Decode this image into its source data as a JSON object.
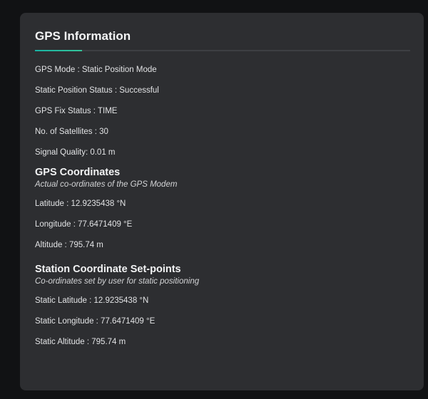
{
  "card": {
    "title": "GPS Information",
    "info_rows": [
      "GPS Mode : Static Position Mode",
      "Static Position Status : Successful",
      "GPS Fix Status : TIME",
      "No. of Satellites : 30",
      "Signal Quality: 0.01 m"
    ]
  },
  "coordinates": {
    "title": "GPS Coordinates",
    "subtitle": "Actual co-ordinates of the GPS Modem",
    "rows": [
      "Latitude : 12.9235438 °N",
      "Longitude : 77.6471409 °E",
      "Altitude : 795.74 m"
    ]
  },
  "setpoints": {
    "title": "Station Coordinate Set-points",
    "subtitle": "Co-ordinates set by user for static positioning",
    "rows": [
      "Static Latitude : 12.9235438 °N",
      "Static Longitude : 77.6471409 °E",
      "Static Altitude : 795.74 m"
    ]
  },
  "colors": {
    "card_background": "#2d2e31",
    "accent": "#18b3a4",
    "page_background": "#111214"
  }
}
